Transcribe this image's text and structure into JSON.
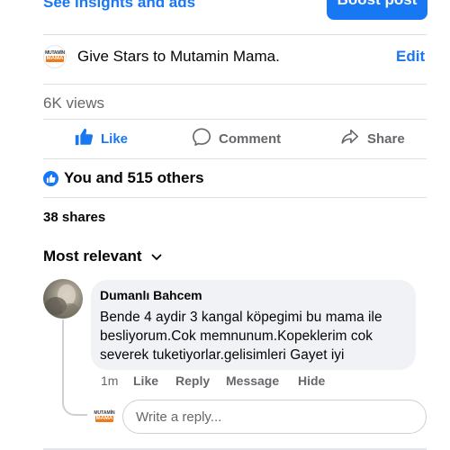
{
  "header": {
    "insights_link": "See insights and ads",
    "boost_button": "Boost post"
  },
  "rating_prompt": {
    "logo_top": "MUTAMİN",
    "logo_bottom": "MAMA",
    "text": "Give Stars to Mutamin Mama.",
    "edit": "Edit"
  },
  "stats": {
    "views": "6K views",
    "reactions": "You and 515 others",
    "shares": "38 shares"
  },
  "actions": {
    "like": "Like",
    "comment": "Comment",
    "share": "Share"
  },
  "comments_sort": "Most relevant",
  "comment": {
    "author": "Dumanlı Bahcem",
    "text": "Bende 4 aydir 3 kangal köpegimi bu mama ile besliyorum.Cok memnunum.Kopeklerim cok severek tuketiyorlar.gelisimleri Gayet iyi",
    "time": "1m",
    "like": "Like",
    "reply": "Reply",
    "message": "Message",
    "hide": "Hide"
  },
  "reply_box": {
    "placeholder": "Write a reply..."
  },
  "colors": {
    "accent": "#1877f2",
    "secondary_text": "#65676b",
    "bubble": "#f0f2f5"
  }
}
